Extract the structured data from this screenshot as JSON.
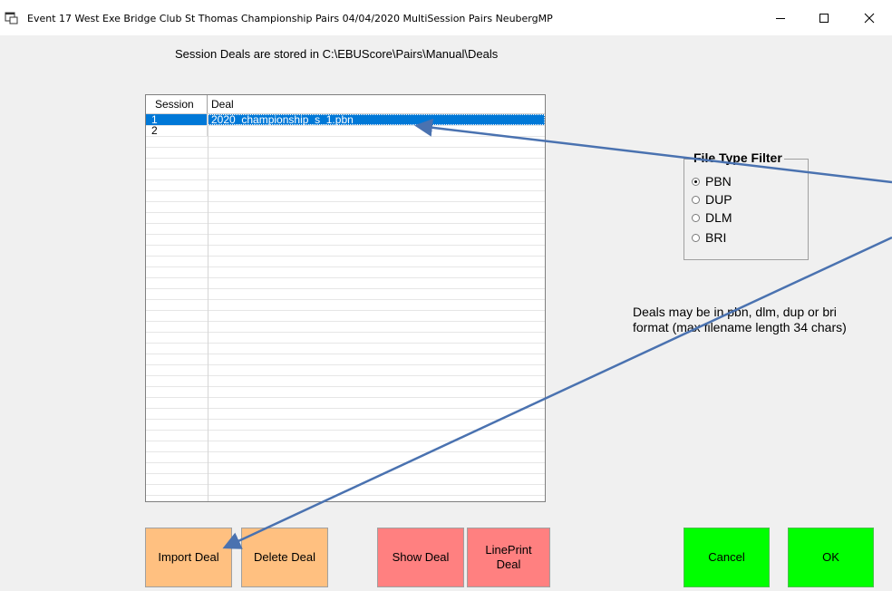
{
  "window": {
    "title": "Event 17  West Exe Bridge Club St Thomas Championship Pairs 04/04/2020 MultiSession Pairs NeubergMP"
  },
  "info_text": "Session Deals are stored in C:\\EBUScore\\Pairs\\Manual\\Deals",
  "grid": {
    "columns": [
      "Session",
      "Deal"
    ],
    "rows": [
      {
        "session": "1",
        "deal": "2020_championship_s_1.pbn",
        "selected": true
      },
      {
        "session": "2",
        "deal": "",
        "selected": false
      }
    ]
  },
  "file_filter": {
    "title": "File Type Filter",
    "options": [
      "PBN",
      "DUP",
      "DLM",
      "BRI"
    ],
    "selected": "PBN"
  },
  "note": "Deals may be in pbn, dlm, dup or bri format (max filename length 34 chars)",
  "buttons": {
    "import": "Import Deal",
    "delete": "Delete Deal",
    "show": "Show Deal",
    "lineprint": "LinePrint Deal",
    "cancel": "Cancel",
    "ok": "OK"
  },
  "colors": {
    "selection": "#0078d7",
    "orange_button": "#ffc080",
    "red_button": "#ff8080",
    "green_button": "#00ff00",
    "annotation_arrow": "#4a72b0"
  }
}
